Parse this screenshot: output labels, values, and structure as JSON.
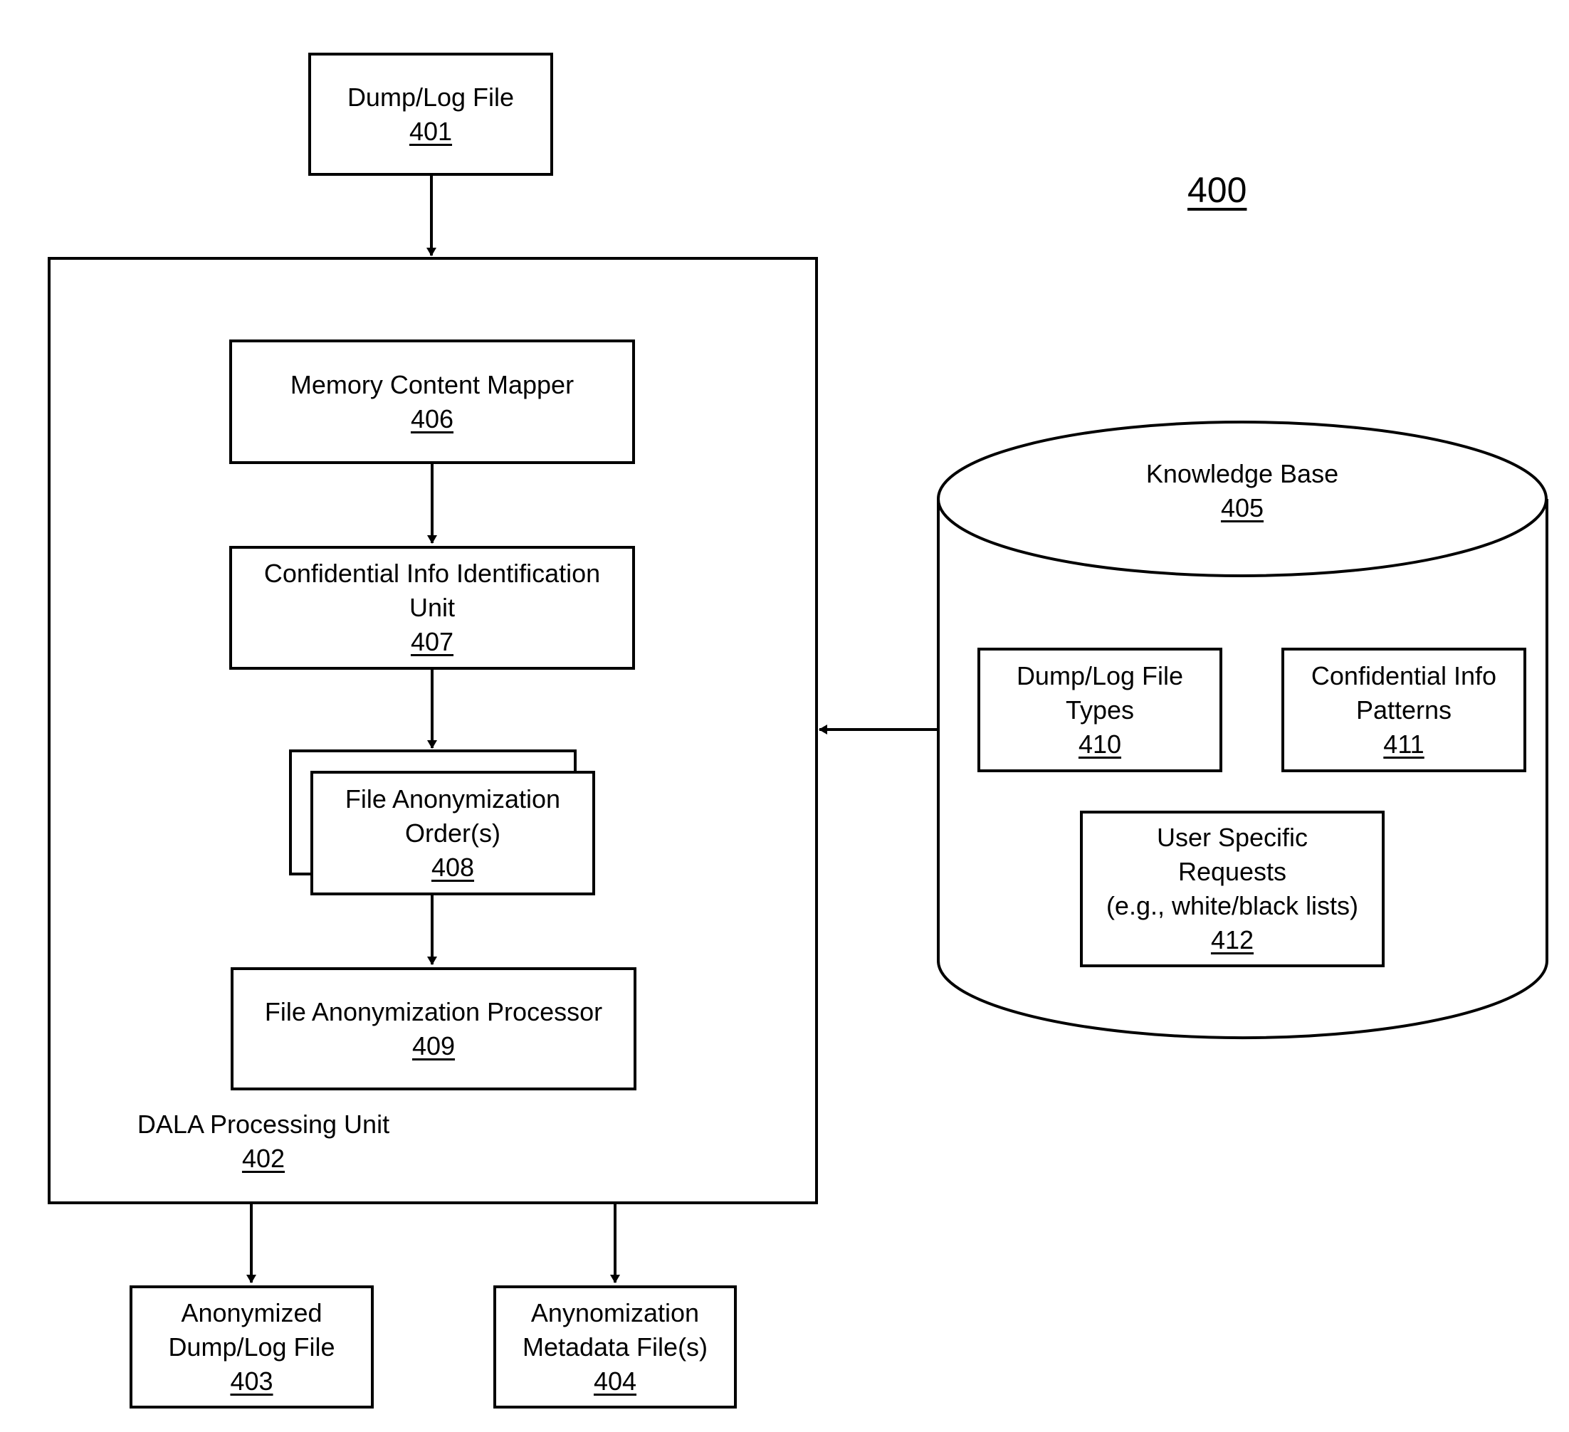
{
  "figure": {
    "number": "400"
  },
  "nodes": {
    "dump_log_file": {
      "title": "Dump/Log File",
      "number": "401"
    },
    "dala_processing_unit": {
      "title": "DALA Processing Unit",
      "number": "402"
    },
    "anonymized_file": {
      "line1": "Anonymized",
      "line2": "Dump/Log File",
      "number": "403"
    },
    "metadata_files": {
      "line1": "Anynomization",
      "line2": "Metadata File(s)",
      "number": "404"
    },
    "knowledge_base": {
      "title": "Knowledge Base",
      "number": "405"
    },
    "memory_content_mapper": {
      "title": "Memory Content Mapper",
      "number": "406"
    },
    "confidential_info_id_unit": {
      "line1": "Confidential Info Identification",
      "line2": "Unit",
      "number": "407"
    },
    "file_anonymization_orders": {
      "line1": "File Anonymization",
      "line2": "Order(s)",
      "number": "408"
    },
    "file_anonymization_processor": {
      "title": "File Anonymization Processor",
      "number": "409"
    },
    "file_types": {
      "line1": "Dump/Log File",
      "line2": "Types",
      "number": "410"
    },
    "confidential_patterns": {
      "line1": "Confidential Info",
      "line2": "Patterns",
      "number": "411"
    },
    "user_requests": {
      "line1": "User Specific",
      "line2": "Requests",
      "line3": "(e.g., white/black lists)",
      "number": "412"
    }
  },
  "edges": [
    {
      "from": "401",
      "to": "402"
    },
    {
      "from": "406",
      "to": "407"
    },
    {
      "from": "407",
      "to": "408"
    },
    {
      "from": "408",
      "to": "409"
    },
    {
      "from": "405",
      "to": "402"
    },
    {
      "from": "402",
      "to": "403"
    },
    {
      "from": "402",
      "to": "404"
    }
  ]
}
